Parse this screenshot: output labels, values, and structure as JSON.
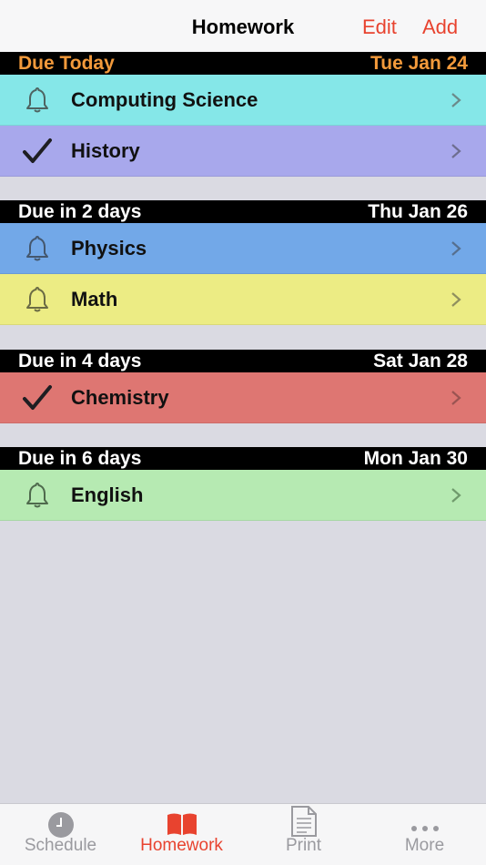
{
  "nav": {
    "title": "Homework",
    "edit_label": "Edit",
    "add_label": "Add"
  },
  "colors": {
    "accent": "#e8432f",
    "today_header": "#f39a3b",
    "computing_science": "#85e7e8",
    "history": "#a8a8ec",
    "physics": "#72a8e8",
    "math": "#ecec84",
    "chemistry": "#de7672",
    "english": "#b6eab2"
  },
  "sections": [
    {
      "label": "Due Today",
      "date": "Tue Jan 24",
      "items": [
        {
          "label": "Computing Science",
          "status_icon": "bell-icon"
        },
        {
          "label": "History",
          "status_icon": "checkmark-icon"
        }
      ]
    },
    {
      "label": "Due in 2 days",
      "date": "Thu Jan 26",
      "items": [
        {
          "label": "Physics",
          "status_icon": "bell-icon"
        },
        {
          "label": "Math",
          "status_icon": "bell-icon"
        }
      ]
    },
    {
      "label": "Due in 4 days",
      "date": "Sat Jan 28",
      "items": [
        {
          "label": "Chemistry",
          "status_icon": "checkmark-icon"
        }
      ]
    },
    {
      "label": "Due in 6 days",
      "date": "Mon Jan 30",
      "items": [
        {
          "label": "English",
          "status_icon": "bell-icon"
        }
      ]
    }
  ],
  "tabs": [
    {
      "label": "Schedule",
      "icon": "clock-icon",
      "active": false
    },
    {
      "label": "Homework",
      "icon": "book-icon",
      "active": true
    },
    {
      "label": "Print",
      "icon": "document-icon",
      "active": false
    },
    {
      "label": "More",
      "icon": "ellipsis-icon",
      "active": false
    }
  ]
}
